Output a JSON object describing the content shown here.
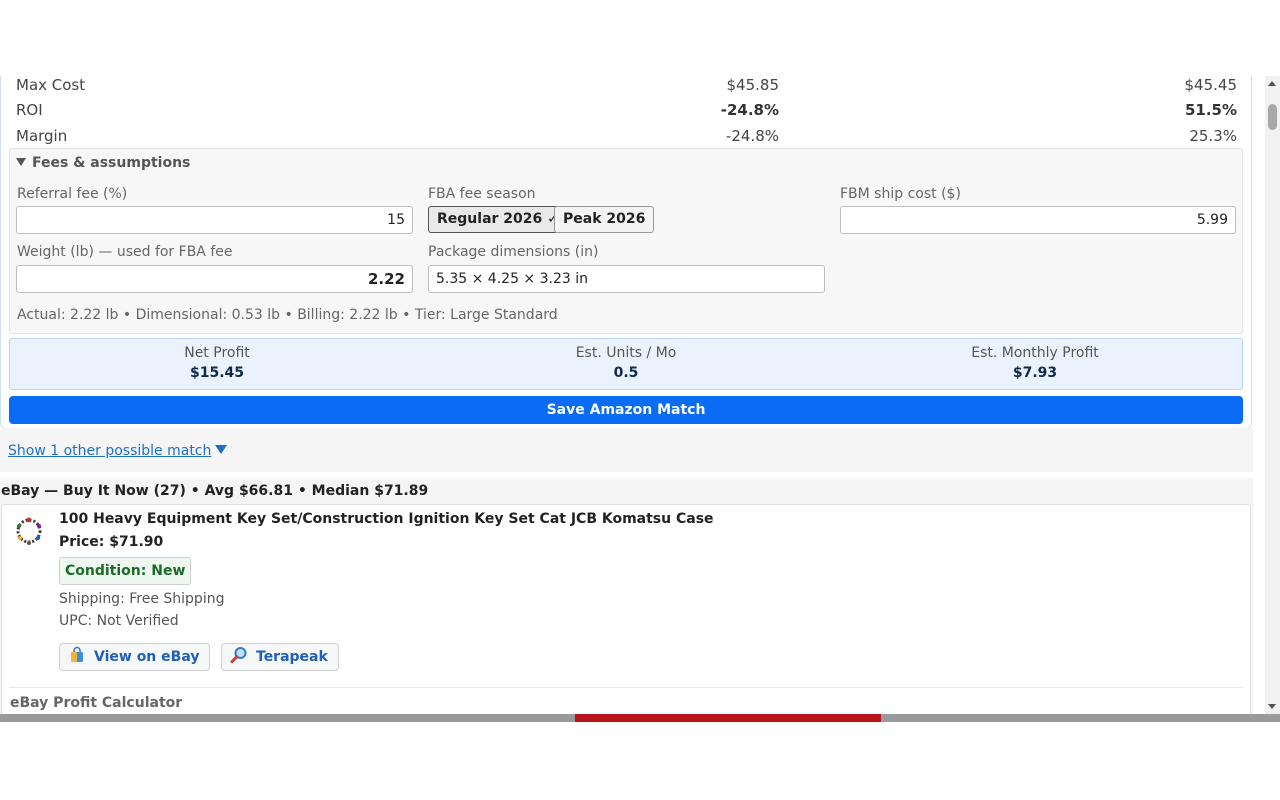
{
  "metrics": [
    {
      "label": "Max Cost",
      "value_a": "$45.85",
      "value_b": "$45.45",
      "bold": false
    },
    {
      "label": "ROI",
      "value_a": "-24.8%",
      "value_b": "51.5%",
      "bold": true
    },
    {
      "label": "Margin",
      "value_a": "-24.8%",
      "value_b": "25.3%",
      "bold": false
    }
  ],
  "fees": {
    "toggle_label": "Fees & assumptions",
    "referral_label": "Referral fee (%)",
    "referral_value": "15",
    "season_label": "FBA fee season",
    "season_regular": "Regular 2026 ✓",
    "season_peak": "Peak 2026",
    "fbm_label": "FBM ship cost ($)",
    "fbm_value": "5.99",
    "weight_label": "Weight (lb) — used for FBA fee",
    "weight_value": "2.22",
    "dims_label": "Package dimensions (in)",
    "dims_value": "5.35 × 4.25 × 3.23 in",
    "dims_info": "Actual: 2.22 lb • Dimensional: 0.53 lb • Billing: 2.22 lb • Tier: Large Standard"
  },
  "summary": {
    "net_profit_label": "Net Profit",
    "net_profit_value": "$15.45",
    "units_label": "Est. Units / Mo",
    "units_value": "0.5",
    "monthly_label": "Est. Monthly Profit",
    "monthly_value": "$7.93"
  },
  "save_button": "Save Amazon Match",
  "other_match_link": "Show 1 other possible match",
  "ebay": {
    "header": "eBay — Buy It Now (27) • Avg $66.81 • Median $71.89",
    "item": {
      "title": "100 Heavy Equipment Key Set/Construction Ignition Key Set Cat JCB Komatsu Case",
      "price": "Price: $71.90",
      "condition": "Condition: New",
      "shipping": "Shipping: Free Shipping",
      "upc": "UPC: Not Verified"
    },
    "view_button": "View on eBay",
    "terapeak_button": "Terapeak",
    "calculator_title": "eBay Profit Calculator"
  },
  "colors": {
    "primary_button": "#0a6cf5",
    "link": "#1f6fc5",
    "summary_bg": "#eaf3fd",
    "condition_green": "#1c6b2a"
  }
}
